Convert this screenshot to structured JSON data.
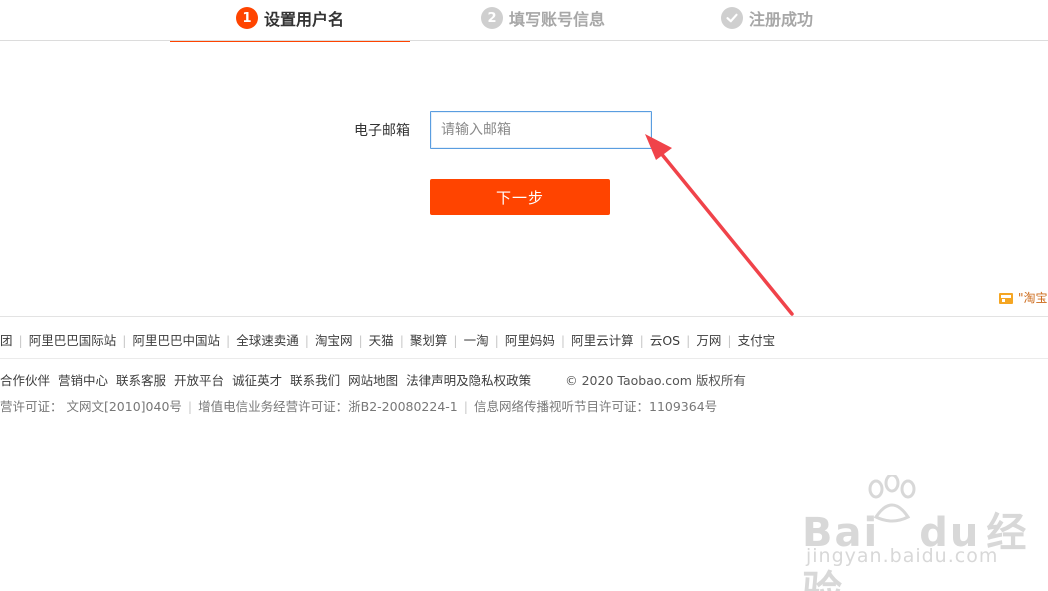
{
  "steps": [
    {
      "num": "1",
      "label": "设置用户名",
      "active": true
    },
    {
      "num": "2",
      "label": "填写账号信息",
      "active": false
    },
    {
      "num": "",
      "label": "注册成功",
      "active": false
    }
  ],
  "form": {
    "email_label": "电子邮箱",
    "email_placeholder": "请输入邮箱",
    "email_value": "",
    "next_label": "下一步"
  },
  "badge": {
    "text": "\"淘宝"
  },
  "footer": {
    "links": [
      "团",
      "阿里巴巴国际站",
      "阿里巴巴中国站",
      "全球速卖通",
      "淘宝网",
      "天猫",
      "聚划算",
      "一淘",
      "阿里妈妈",
      "阿里云计算",
      "云OS",
      "万网",
      "支付宝"
    ],
    "info_links": [
      "合作伙伴",
      "营销中心",
      "联系客服",
      "开放平台",
      "诚征英才",
      "联系我们",
      "网站地图",
      "法律声明及隐私权政策"
    ],
    "copyright": "© 2020 Taobao.com 版权所有",
    "licenses": [
      "营许可证：  文网文[2010]040号",
      "增值电信业务经营许可证：浙B2-20080224-1",
      "信息网络传播视听节目许可证：1109364号"
    ]
  },
  "watermark": {
    "brand": "Bai",
    "brand2": "du",
    "cn": "经验",
    "url": "jingyan.baidu.com"
  },
  "colors": {
    "accent": "#ff4400",
    "input_border": "#5a9de0",
    "arrow": "#f0434a"
  }
}
